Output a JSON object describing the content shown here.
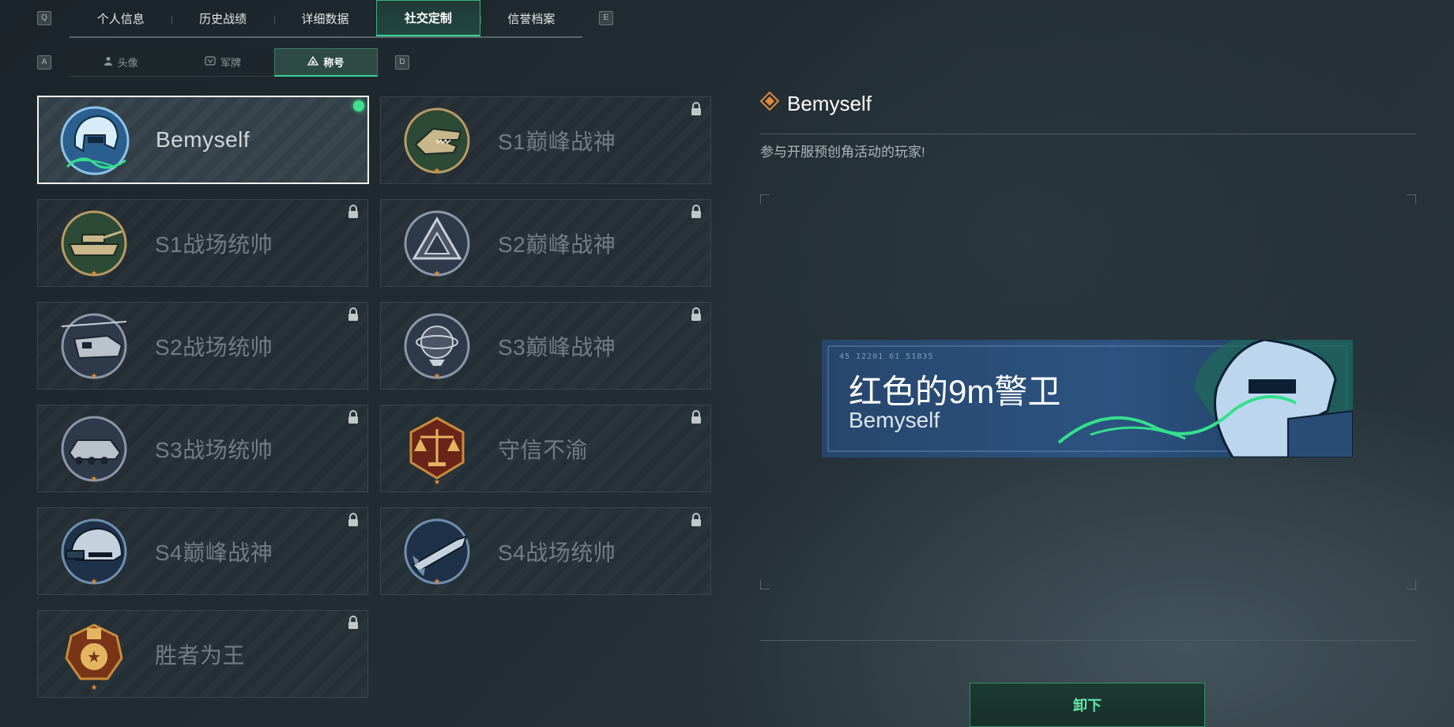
{
  "tabs": {
    "prev_key": "Q",
    "next_key": "E",
    "items": [
      {
        "label": "个人信息"
      },
      {
        "label": "历史战绩"
      },
      {
        "label": "详细数据"
      },
      {
        "label": "社交定制",
        "active": true
      },
      {
        "label": "信誉档案"
      }
    ]
  },
  "subtabs": {
    "prev_key": "A",
    "next_key": "D",
    "items": [
      {
        "label": "头像",
        "icon": "person-icon"
      },
      {
        "label": "军牌",
        "icon": "dogtag-icon"
      },
      {
        "label": "称号",
        "icon": "title-triangle-icon",
        "active": true
      }
    ]
  },
  "titles": [
    {
      "label": "Bemyself",
      "badge": "bemyself-emblem",
      "selected": true,
      "equipped": true
    },
    {
      "label": "S1巅峰战神",
      "badge": "crocodile-emblem",
      "locked": true
    },
    {
      "label": "S1战场统帅",
      "badge": "tank-emblem",
      "locked": true
    },
    {
      "label": "S2巅峰战神",
      "badge": "triangle-emblem",
      "locked": true
    },
    {
      "label": "S2战场统帅",
      "badge": "helicopter-emblem",
      "locked": true
    },
    {
      "label": "S3巅峰战神",
      "badge": "globe-emblem",
      "locked": true
    },
    {
      "label": "S3战场统帅",
      "badge": "apc-emblem",
      "locked": true
    },
    {
      "label": "守信不渝",
      "badge": "scales-emblem",
      "locked": true
    },
    {
      "label": "S4巅峰战神",
      "badge": "helmet-emblem",
      "locked": true
    },
    {
      "label": "S4战场统帅",
      "badge": "missile-emblem",
      "locked": true
    },
    {
      "label": "胜者为王",
      "badge": "medal-emblem",
      "locked": true
    }
  ],
  "detail": {
    "title": "Bemyself",
    "description": "参与开服预创角活动的玩家!",
    "banner_main": "红色的9m警卫",
    "banner_sub": "Bemyself",
    "banner_code": "45 12201   61 51835",
    "unequip_label": "卸下"
  },
  "colors": {
    "accent_green": "#38d39a",
    "equipped_dot": "#3ee08f",
    "badge_orange": "#e08a3a"
  }
}
